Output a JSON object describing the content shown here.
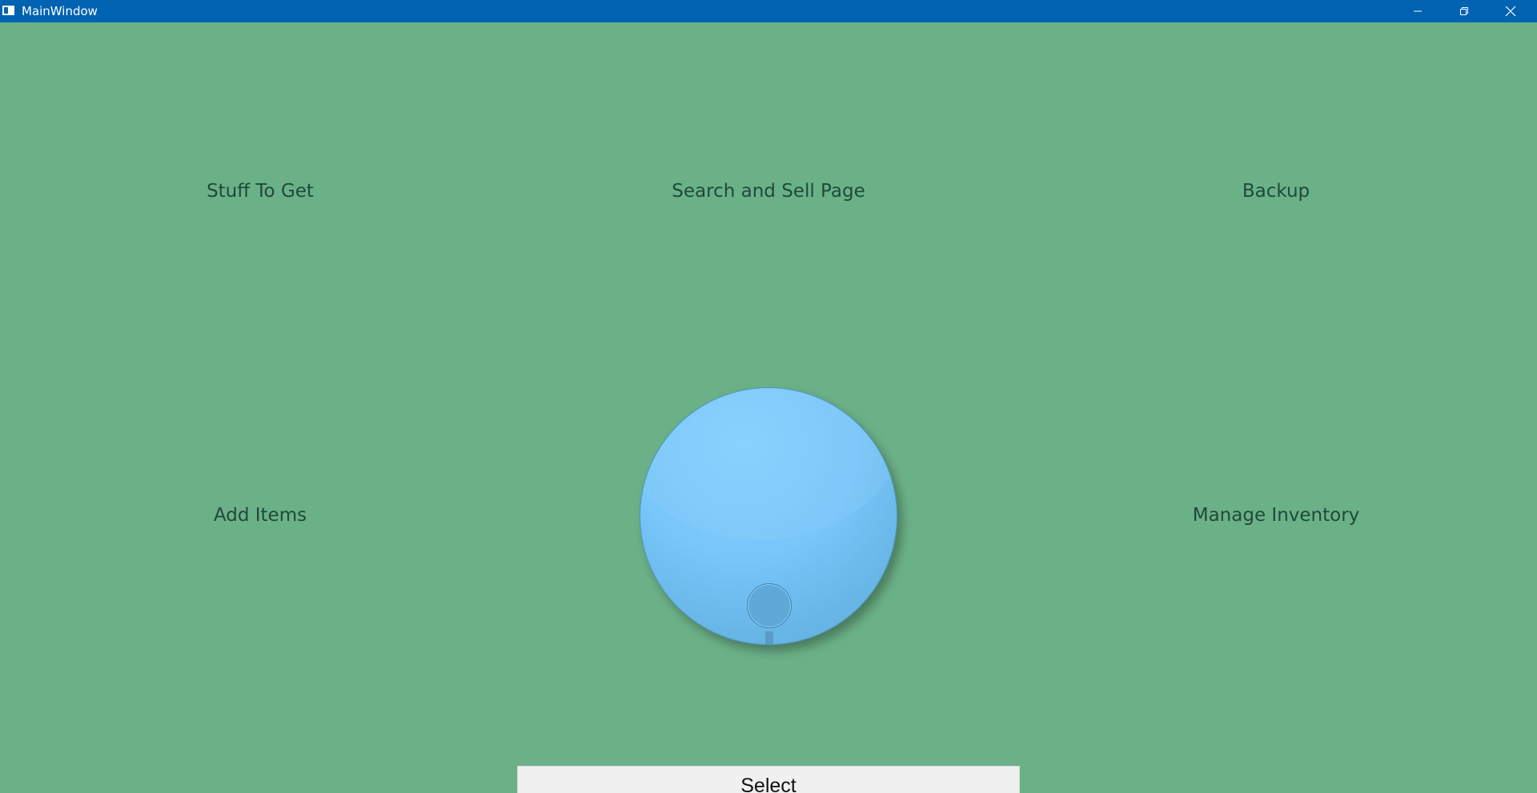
{
  "window": {
    "title": "MainWindow",
    "background_color": "#6bb187",
    "titlebar_color": "#0063b1"
  },
  "titlebar": {
    "icons": {
      "app": "app-window-icon",
      "minimize": "minimize-icon",
      "maximize": "restore-icon",
      "close": "close-icon"
    }
  },
  "menu": {
    "items": [
      {
        "label": "Stuff To Get"
      },
      {
        "label": "Search and Sell Page"
      },
      {
        "label": "Backup"
      },
      {
        "label": "Add Items"
      },
      {
        "label": "Manage Inventory"
      }
    ]
  },
  "dial": {
    "color": "#78c6fa",
    "icon": "dial-knob"
  },
  "select_button": {
    "label": "Select"
  }
}
